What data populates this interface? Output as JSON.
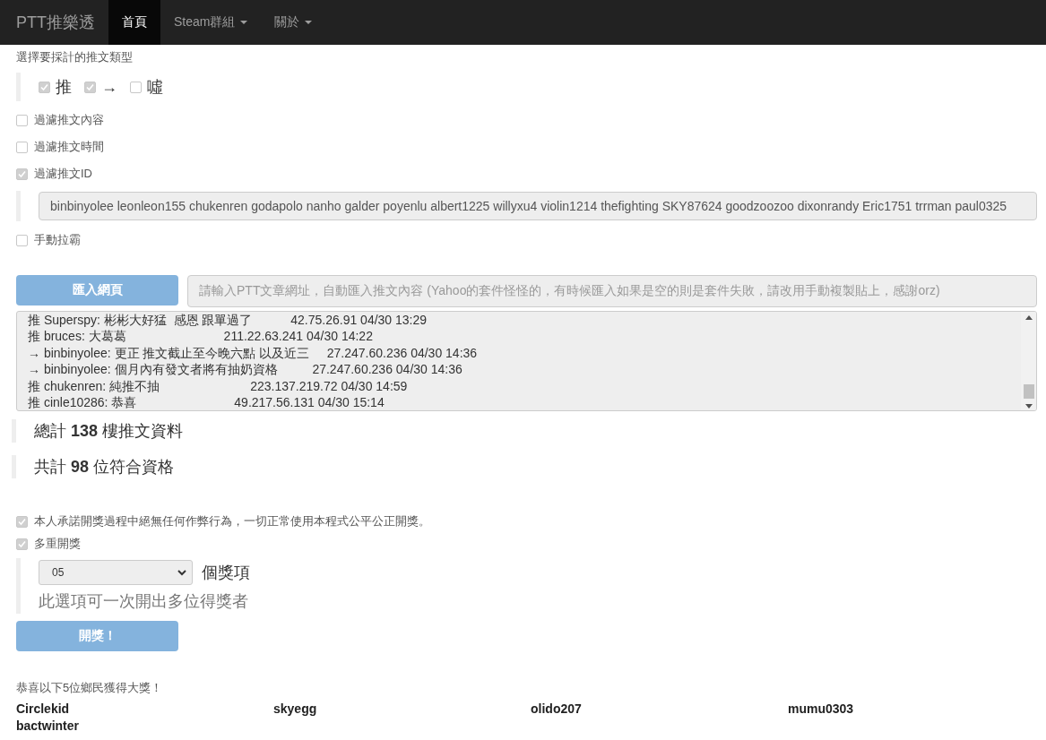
{
  "navbar": {
    "brand": "PTT推樂透",
    "items": [
      {
        "label": "首頁",
        "selected": true,
        "dropdown": false
      },
      {
        "label": "Steam群組",
        "selected": false,
        "dropdown": true
      },
      {
        "label": "關於",
        "selected": false,
        "dropdown": true
      }
    ]
  },
  "type_section": {
    "label": "選擇要採計的推文類型",
    "types": [
      {
        "label": "推",
        "checked": true
      },
      {
        "label": "→",
        "checked": true
      },
      {
        "label": "噓",
        "checked": false
      }
    ]
  },
  "filters": [
    {
      "label": "過濾推文內容",
      "checked": false
    },
    {
      "label": "過濾推文時間",
      "checked": false
    },
    {
      "label": "過濾推文ID",
      "checked": true,
      "value": "binbinyolee leonleon155 chukenren godapolo nanho galder poyenlu albert1225 willyxu4 violin1214 thefighting SKY87624 goodzoozoo dixonrandy Eric1751 trrman paul0325"
    },
    {
      "label": "手動拉霸",
      "checked": false
    }
  ],
  "import": {
    "button": "匯入網頁",
    "placeholder": "請輸入PTT文章網址，自動匯入推文內容 (Yahoo的套件怪怪的，有時候匯入如果是空的則是套件失敗，請改用手動複製貼上，感謝orz)"
  },
  "comments": [
    "推 Superspy: 彬彬大好猛  感恩 跟單過了           42.75.26.91 04/30 13:29",
    "推 bruces: 大葛葛                            211.22.63.241 04/30 14:22",
    "→ binbinyolee: 更正 推文截止至今晚六點 以及近三     27.247.60.236 04/30 14:36",
    "→ binbinyolee: 個月內有發文者將有抽奶資格          27.247.60.236 04/30 14:36",
    "推 chukenren: 純推不抽                          223.137.219.72 04/30 14:59",
    "推 cinle10286: 恭喜                            49.217.56.131 04/30 15:14"
  ],
  "summary": [
    {
      "text": "總計 **138** 樓推文資料"
    },
    {
      "text": "共計 **98** 位符合資格"
    }
  ],
  "promise": {
    "label": "本人承諾開獎過程中絕無任何作弊行為，一切正常使用本程式公平公正開獎。",
    "checked": true
  },
  "multi": {
    "label": "多重開獎",
    "checked": true,
    "count": "05",
    "unit": "個獎項",
    "hint": "此選項可一次開出多位得獎者"
  },
  "draw_button": "開獎！",
  "result": {
    "title": "恭喜以下5位鄉民獲得大獎！",
    "winners": [
      "Circlekid",
      "skyegg",
      "olido207",
      "mumu0303",
      "bactwinter"
    ]
  }
}
